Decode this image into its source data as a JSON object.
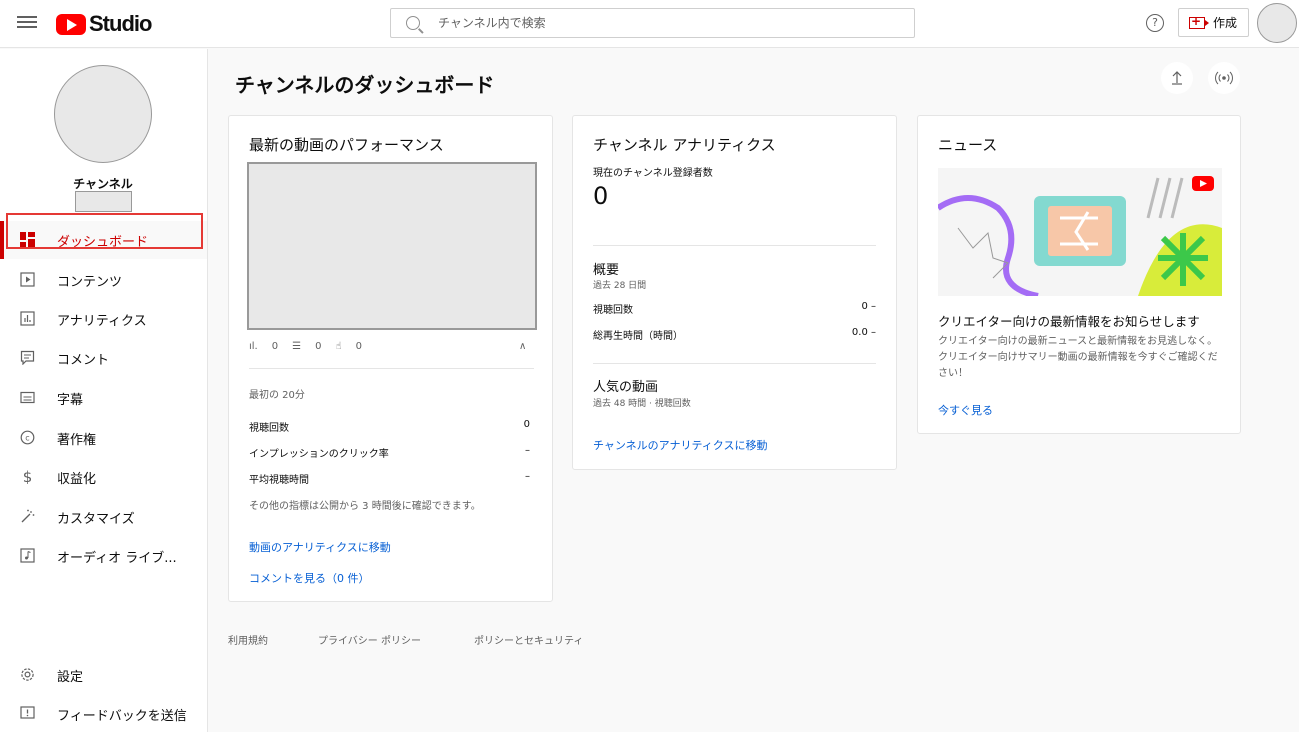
{
  "header": {
    "logo_text": "Studio",
    "search_placeholder": "チャンネル内で検索",
    "help_icon": "?",
    "create_label": "作成"
  },
  "sidebar": {
    "channel_label": "チャンネル",
    "items": [
      {
        "label": "ダッシュボード",
        "icon": "dashboard-icon"
      },
      {
        "label": "コンテンツ",
        "icon": "content-icon"
      },
      {
        "label": "アナリティクス",
        "icon": "analytics-icon"
      },
      {
        "label": "コメント",
        "icon": "comments-icon"
      },
      {
        "label": "字幕",
        "icon": "subtitles-icon"
      },
      {
        "label": "著作権",
        "icon": "copyright-icon"
      },
      {
        "label": "収益化",
        "icon": "monetization-icon"
      },
      {
        "label": "カスタマイズ",
        "icon": "customize-icon"
      },
      {
        "label": "オーディオ ライブ...",
        "icon": "audio-library-icon"
      }
    ],
    "bottom_items": [
      {
        "label": "設定",
        "icon": "settings-icon"
      },
      {
        "label": "フィードバックを送信",
        "icon": "feedback-icon"
      }
    ]
  },
  "main": {
    "title": "チャンネルのダッシュボード",
    "latest_video": {
      "title": "最新の動画のパフォーマンス",
      "views_stat": "0",
      "comments_stat": "0",
      "likes_stat": "0",
      "period": "最初の 20分",
      "metrics": [
        {
          "label": "視聴回数",
          "value": "0"
        },
        {
          "label": "インプレッションのクリック率",
          "value": "–"
        },
        {
          "label": "平均視聴時間",
          "value": "–"
        }
      ],
      "note": "その他の指標は公開から 3 時間後に確認できます。",
      "analytics_link": "動画のアナリティクスに移動",
      "comments_link": "コメントを見る（0 件）"
    },
    "channel_analytics": {
      "title": "チャンネル アナリティクス",
      "subs_label": "現在のチャンネル登録者数",
      "subs_value": "0",
      "summary_title": "概要",
      "summary_period": "過去 28 日間",
      "metrics": [
        {
          "label": "視聴回数",
          "value": "0 –"
        },
        {
          "label": "総再生時間（時間）",
          "value": "0.0 –"
        }
      ],
      "popular_title": "人気の動画",
      "popular_period": "過去 48 時間 · 視聴回数",
      "link": "チャンネルのアナリティクスに移動"
    },
    "news": {
      "title": "ニュース",
      "headline": "クリエイター向けの最新情報をお知らせします",
      "body": "クリエイター向けの最新ニュースと最新情報をお見逃しなく。クリエイター向けサマリー動画の最新情報を今すぐご確認ください！",
      "link": "今すぐ見る"
    }
  },
  "footer": {
    "links": [
      "利用規約",
      "プライバシー ポリシー",
      "ポリシーとセキュリティ"
    ]
  },
  "colors": {
    "accent_red": "#cc0000",
    "link_blue": "#065fd4"
  }
}
